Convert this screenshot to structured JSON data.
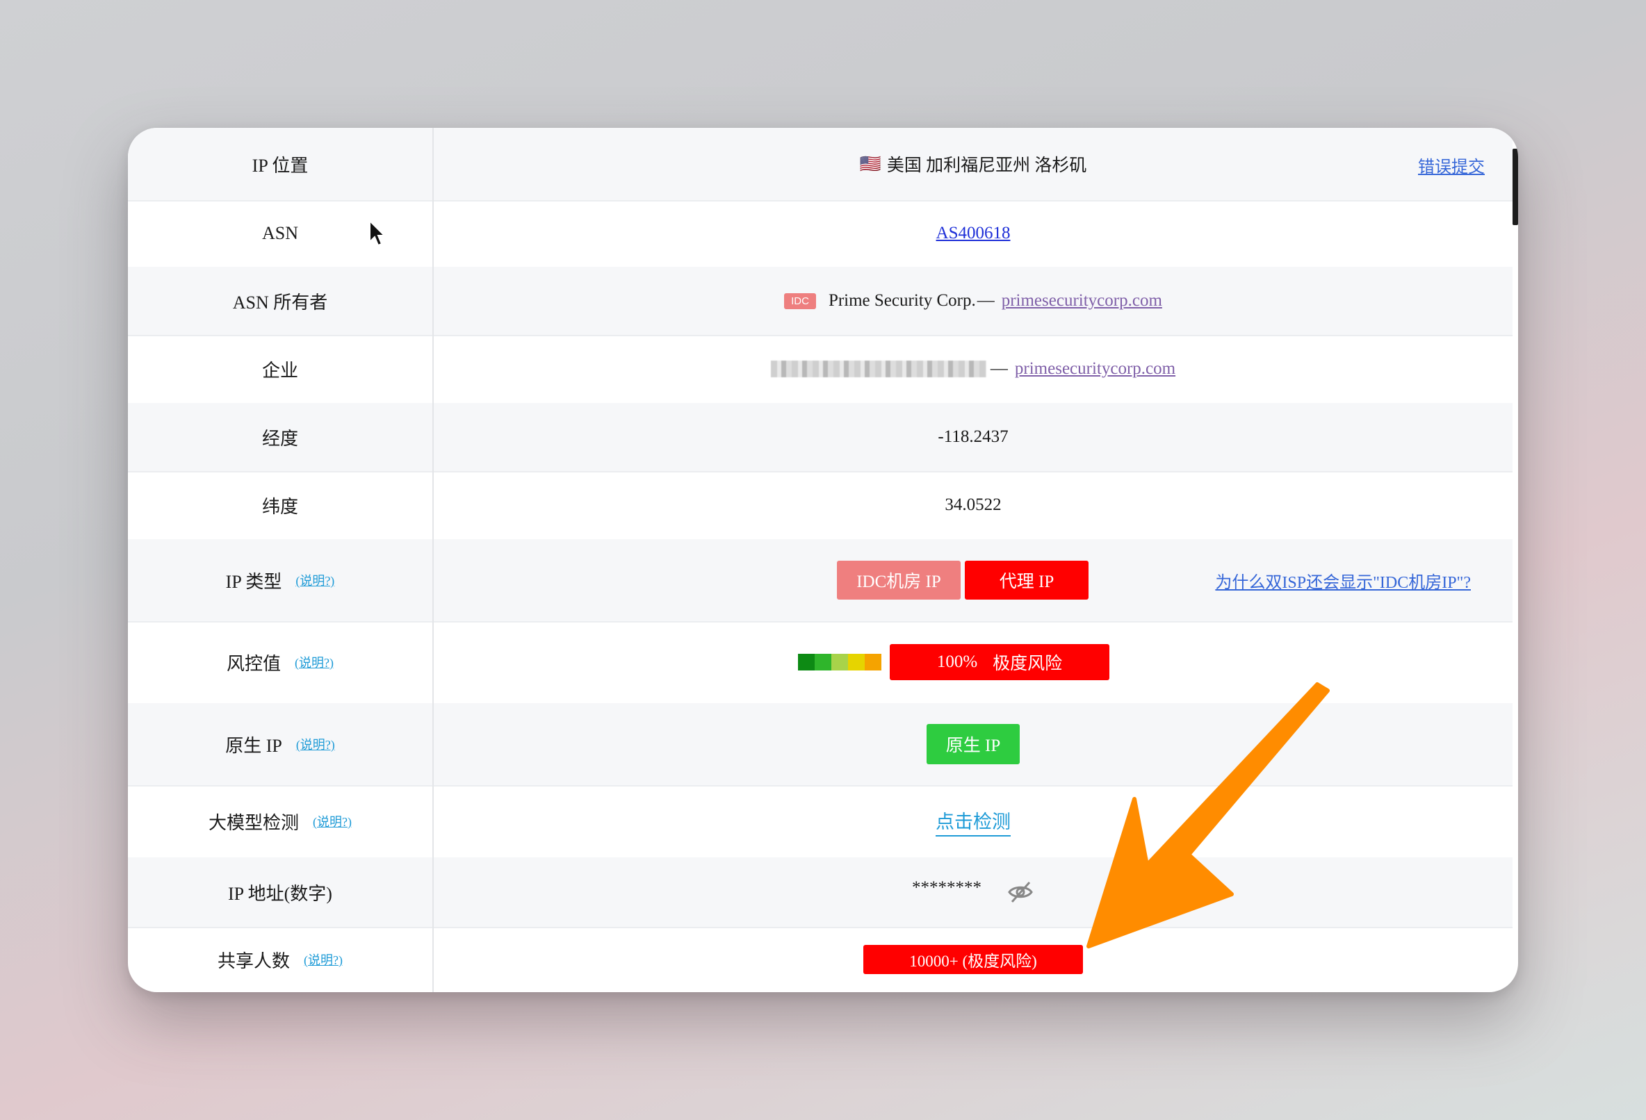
{
  "rows": {
    "location": {
      "label": "IP 位置",
      "flag": "🇺🇸",
      "value": "美国 加利福尼亚州 洛杉矶",
      "report_link": "错误提交"
    },
    "asn": {
      "label": "ASN",
      "value": "AS400618"
    },
    "asn_owner": {
      "label": "ASN 所有者",
      "tag": "IDC",
      "name": "Prime Security Corp.",
      "sep": "—",
      "domain": "primesecuritycorp.com"
    },
    "company": {
      "label": "企业",
      "sep": "—",
      "domain": "primesecuritycorp.com"
    },
    "longitude": {
      "label": "经度",
      "value": "-118.2437"
    },
    "latitude": {
      "label": "纬度",
      "value": "34.0522"
    },
    "ip_type": {
      "label": "IP 类型",
      "help": "(说明?)",
      "badge_idc": "IDC机房 IP",
      "badge_proxy": "代理 IP",
      "why_link": "为什么双ISP还会显示\"IDC机房IP\"?"
    },
    "risk": {
      "label": "风控值",
      "help": "(说明?)",
      "percent": "100%",
      "level": "极度风险",
      "scale_colors": [
        "#0d8a14",
        "#2fb52b",
        "#a8d34a",
        "#e6d400",
        "#f5a300"
      ]
    },
    "native_ip": {
      "label": "原生 IP",
      "help": "(说明?)",
      "badge": "原生 IP"
    },
    "llm_detect": {
      "label": "大模型检测",
      "help": "(说明?)",
      "link": "点击检测"
    },
    "ip_numeric": {
      "label": "IP 地址(数字)",
      "masked": "********"
    },
    "shared_users": {
      "label": "共享人数",
      "help": "(说明?)",
      "badge": "10000+ (极度风险)"
    }
  },
  "colors": {
    "red": "#ff0000",
    "idc_pink": "#ef7f7f",
    "native_green": "#2ecc40",
    "arrow_orange": "#ff8c00"
  }
}
